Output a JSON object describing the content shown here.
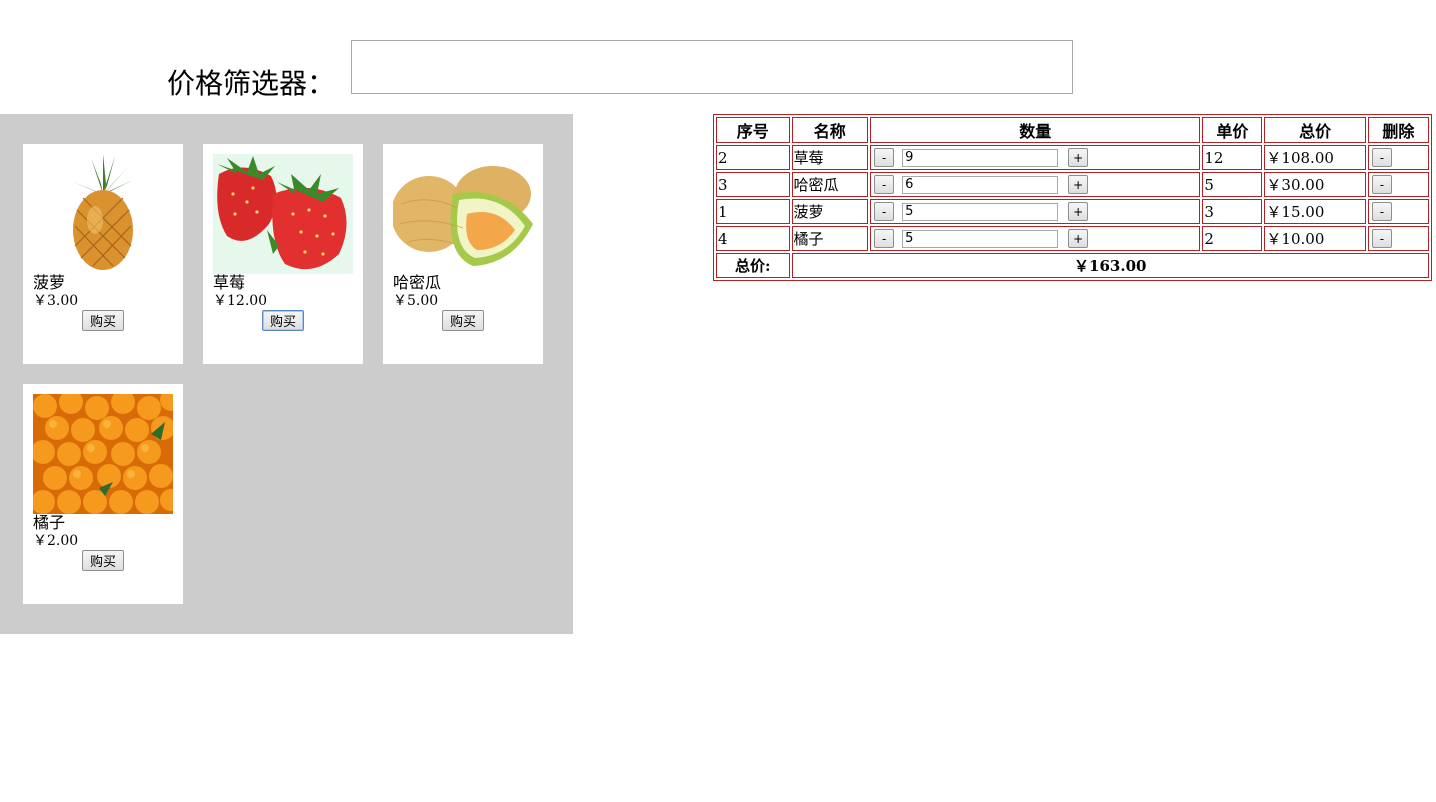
{
  "filter": {
    "label": "价格筛选器：",
    "value": ""
  },
  "products": [
    {
      "name": "菠萝",
      "price": "￥3.00",
      "buy_label": "购买",
      "image": "pineapple"
    },
    {
      "name": "草莓",
      "price": "￥12.00",
      "buy_label": "购买",
      "image": "strawberry"
    },
    {
      "name": "哈密瓜",
      "price": "￥5.00",
      "buy_label": "购买",
      "image": "melon"
    },
    {
      "name": "橘子",
      "price": "￥2.00",
      "buy_label": "购买",
      "image": "tangerine"
    }
  ],
  "cart": {
    "headers": [
      "序号",
      "名称",
      "数量",
      "单价",
      "总价",
      "删除"
    ],
    "rows": [
      {
        "id": "2",
        "name": "草莓",
        "qty": "9",
        "unit": "12",
        "total": "￥108.00"
      },
      {
        "id": "3",
        "name": "哈密瓜",
        "qty": "6",
        "unit": "5",
        "total": "￥30.00"
      },
      {
        "id": "1",
        "name": "菠萝",
        "qty": "5",
        "unit": "3",
        "total": "￥15.00"
      },
      {
        "id": "4",
        "name": "橘子",
        "qty": "5",
        "unit": "2",
        "total": "￥10.00"
      }
    ],
    "minus_label": "-",
    "plus_label": "+",
    "delete_label": "-",
    "total_label": "总价:",
    "total_value": "￥163.00"
  }
}
